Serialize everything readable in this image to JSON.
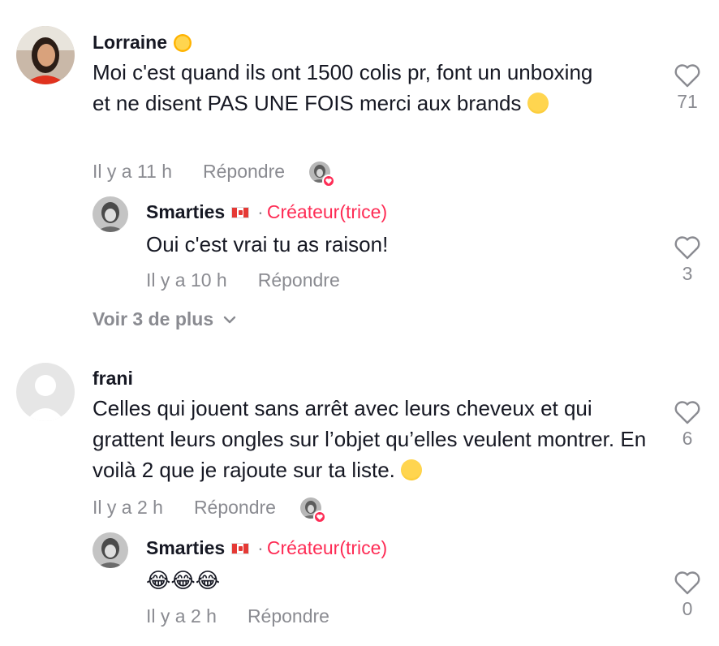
{
  "colors": {
    "accent": "#fe2c55",
    "muted": "#8a8b91",
    "text": "#161823"
  },
  "comments": [
    {
      "username": "Lorraine",
      "text": "Moi c'est quand ils ont 1500 colis pr, font un unboxing et ne disent PAS UNE FOIS merci aux brands",
      "time": "Il y a 11 h",
      "reply_label": "Répondre",
      "likes": "71",
      "replies": [
        {
          "username": "Smarties",
          "badge": "Créateur(trice)",
          "text": "Oui c'est vrai tu as raison!",
          "time": "Il y a 10 h",
          "reply_label": "Répondre",
          "likes": "3"
        }
      ],
      "more_label": "Voir 3 de plus"
    },
    {
      "username": "frani",
      "text": "Celles qui jouent sans arrêt avec leurs cheveux et qui grattent leurs ongles sur l’objet qu’elles veulent montrer. En voilà 2 que je rajoute sur ta liste.",
      "time": "Il y a 2 h",
      "reply_label": "Répondre",
      "likes": "6",
      "replies": [
        {
          "username": "Smarties",
          "badge": "Créateur(trice)",
          "text": "😂😂😂",
          "time": "Il y a 2 h",
          "reply_label": "Répondre",
          "likes": "0"
        }
      ]
    }
  ]
}
